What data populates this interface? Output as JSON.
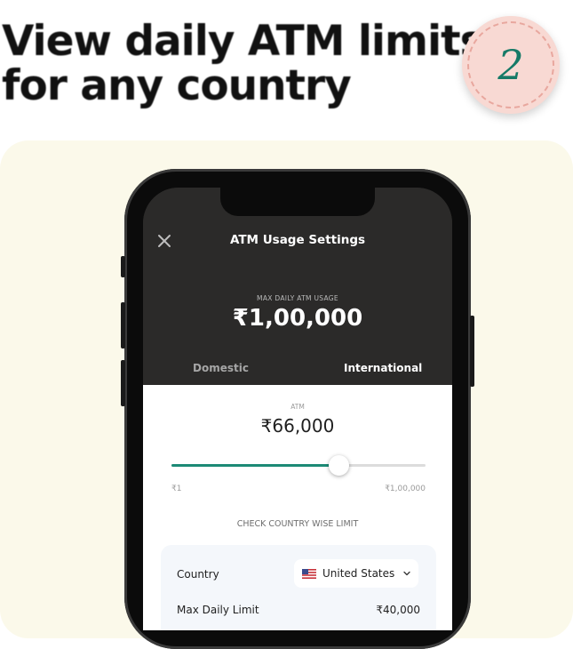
{
  "headline": {
    "line1": "View daily ATM limits",
    "line2": "for any country"
  },
  "step": {
    "number": "2"
  },
  "screen": {
    "title": "ATM Usage Settings",
    "close_icon": "close-icon",
    "max_label": "MAX DAILY ATM USAGE",
    "max_value": "₹1,00,000",
    "tabs": [
      {
        "label": "Domestic",
        "active": false
      },
      {
        "label": "International",
        "active": true
      }
    ],
    "atm_label": "ATM",
    "atm_value": "₹66,000",
    "slider": {
      "min_label": "₹1",
      "max_label": "₹1,00,000",
      "fraction": 0.66
    },
    "check_label": "CHECK COUNTRY WISE LIMIT",
    "country_label": "Country",
    "country_selected": "United States",
    "country_flag": "us-flag-icon",
    "limit_label": "Max Daily Limit",
    "limit_value": "₹40,000"
  },
  "colors": {
    "accent": "#1c8a76",
    "badge_bg": "#f8d9d3",
    "card_bg": "#fbf9ea",
    "dark_header": "#2b2a29"
  }
}
